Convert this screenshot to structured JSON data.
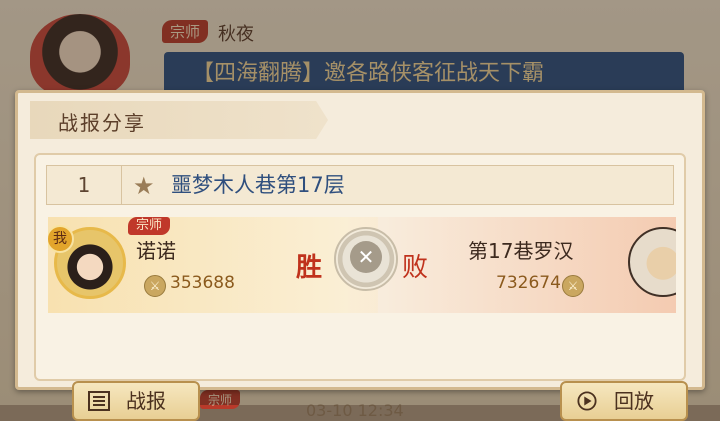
{
  "background": {
    "rank_tag": "宗师",
    "sender": "秋夜",
    "message": "【四海翻腾】邀各路侠客征战天下霸",
    "bottom_tag": "宗师"
  },
  "panel": {
    "title": "战报分享",
    "entry": {
      "index": "1",
      "stage_title": "噩梦木人巷第17层"
    },
    "battle": {
      "me_badge": "我",
      "left_rank": "宗师",
      "left_name": "诺诺",
      "left_power": "353688",
      "result_left": "胜",
      "result_right": "败",
      "right_name": "第17巷罗汉",
      "right_power": "732674",
      "time": "03-10 12:34"
    },
    "buttons": {
      "report": "战报",
      "replay": "回放"
    }
  }
}
